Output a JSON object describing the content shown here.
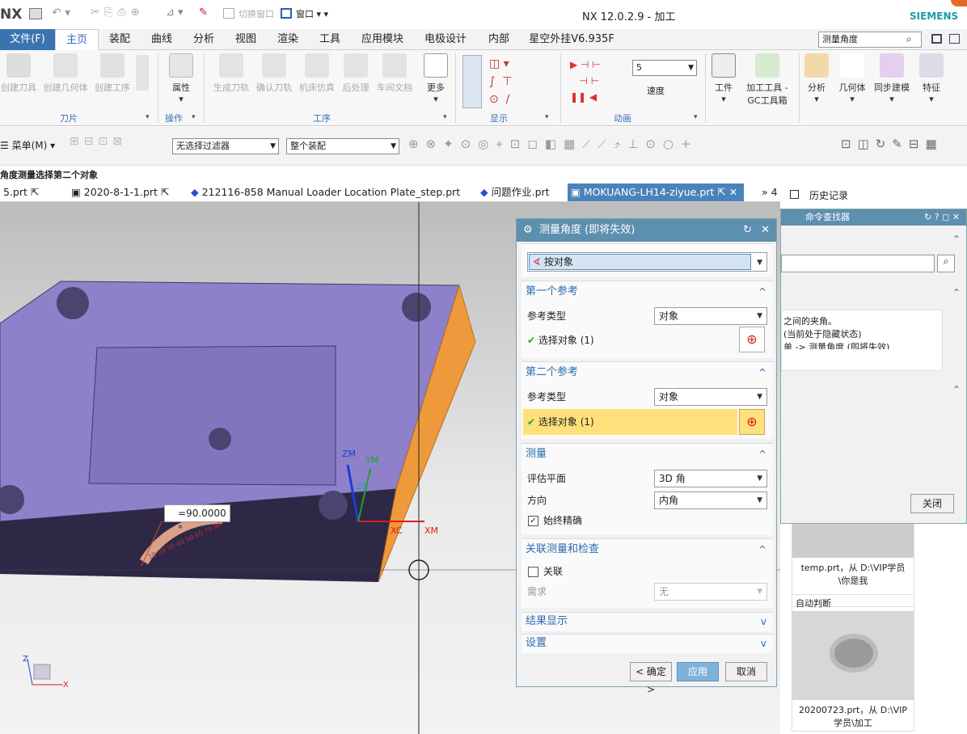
{
  "app": {
    "logo": "NX",
    "title": "NX 12.0.2.9 - 加工",
    "brand": "SIEMENS",
    "switch_window": "切换窗口",
    "window_menu": "窗口"
  },
  "menu": {
    "file": "文件(F)",
    "tabs": [
      "主页",
      "装配",
      "曲线",
      "分析",
      "视图",
      "渲染",
      "工具",
      "应用模块",
      "电极设计",
      "内部",
      "星空外挂V6.935F"
    ],
    "search_placeholder": "测量角度"
  },
  "ribbon": {
    "tools_group": {
      "buttons": [
        "创建刀具",
        "创建几何体",
        "创建工序"
      ],
      "label": "刀片"
    },
    "ops": {
      "button": "属性",
      "label": "操作"
    },
    "process_group": {
      "buttons": [
        "生成刀轨",
        "确认刀轨",
        "机床仿真",
        "后处理",
        "车间文档",
        "更多"
      ],
      "label": "工序"
    },
    "display_label": "显示",
    "anim": {
      "speed_value": "5",
      "speed_label": "速度",
      "label": "动画"
    },
    "right_buttons": [
      "工件",
      "加工工具 - GC工具箱",
      "分析",
      "几何体",
      "同步建模",
      "特征"
    ]
  },
  "toolbar2": {
    "menu": "菜单(M)",
    "filter": "无选择过滤器",
    "assembly": "整个装配"
  },
  "cue": "角度测量选择第二个对象",
  "file_tabs": [
    "5.prt",
    "2020-8-1-1.prt",
    "212116-858 Manual Loader Location Plate_step.prt",
    "问题作业.prt",
    "MOKUANG-LH14-ziyue.prt"
  ],
  "file_tabs_more": "» 4",
  "viewport": {
    "angle_readout": "=90.0000 °",
    "axes": {
      "zm": "ZM",
      "ym": "YM",
      "zc": "ZC",
      "xc": "XC",
      "xm": "XM",
      "x": "X",
      "z": "Z"
    },
    "protractor_ticks": "10 20 30 40 50 60 70 80"
  },
  "dialog": {
    "title": "测量角度 (即将失效)",
    "type_value": "按对象",
    "sec1": {
      "title": "第一个参考",
      "ref_type_label": "参考类型",
      "ref_type_value": "对象",
      "select_label": "选择对象 (1)"
    },
    "sec2": {
      "title": "第二个参考",
      "ref_type_label": "参考类型",
      "ref_type_value": "对象",
      "select_label": "选择对象 (1)"
    },
    "measure": {
      "title": "测量",
      "plane_label": "评估平面",
      "plane_value": "3D 角",
      "dir_label": "方向",
      "dir_value": "内角",
      "precise_label": "始终精确"
    },
    "assoc": {
      "title": "关联测量和检查",
      "assoc_label": "关联",
      "req_label": "需求",
      "req_value": "无"
    },
    "result_title": "结果显示",
    "settings_title": "设置",
    "ok": "< 确定 >",
    "apply": "应用",
    "cancel": "取消"
  },
  "cmd_panel": {
    "title": "命令查找器",
    "line1": "之间的夹角。",
    "line2": "(当前处于隐藏状态)",
    "line3": "单 -> 测量角度 (即将失效)",
    "close": "关闭"
  },
  "history": {
    "title": "历史记录",
    "item1": "temp.prt，从 D:\\VIP学员\\你是我",
    "item2_header": "自动判断",
    "item2": "20200723.prt，从 D:\\VIP学员\\加工"
  },
  "colors": {
    "accent": "#4a83b9",
    "highlight": "#ffe07a",
    "part_face": "#8e80c9",
    "orange_face": "#ee9a3c"
  }
}
